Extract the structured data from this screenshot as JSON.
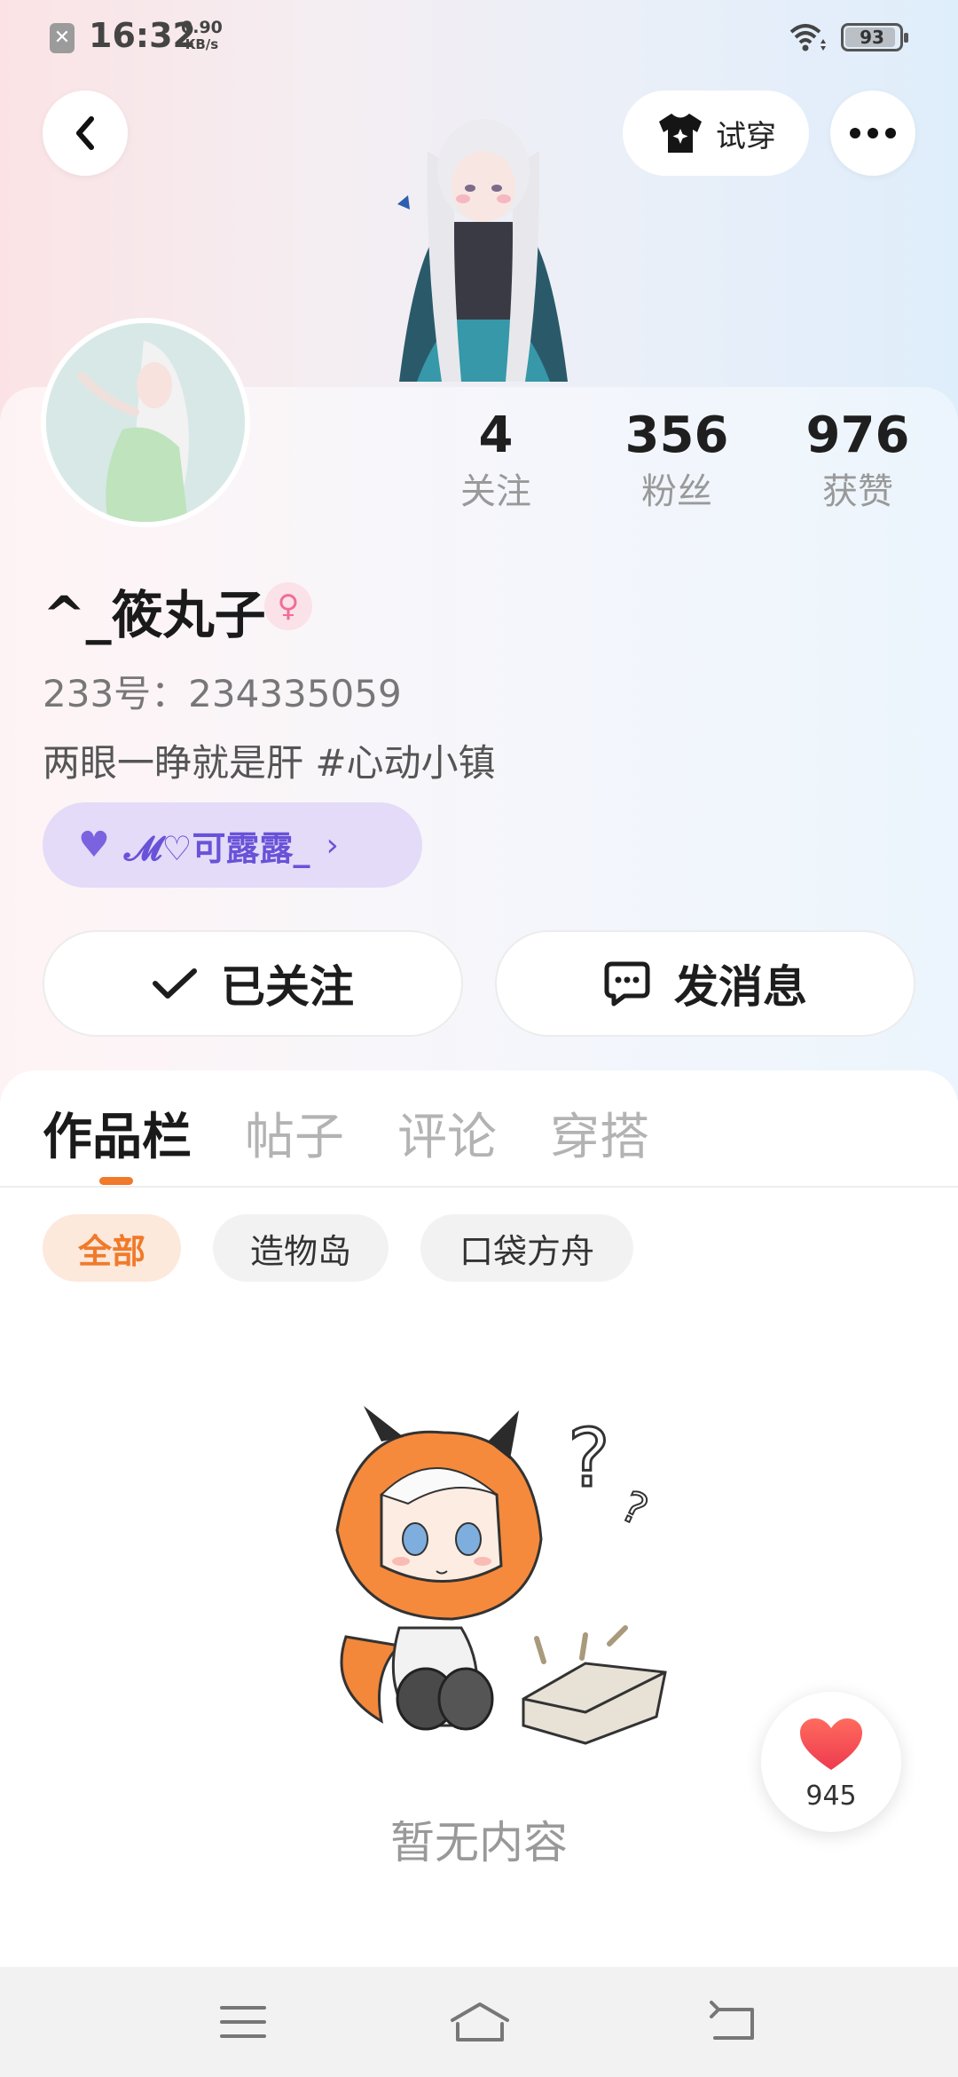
{
  "status_bar": {
    "time": "16:32",
    "speed_value": "0.90",
    "speed_unit": "KB/s",
    "battery": "93",
    "battery_level": 0.93
  },
  "header": {
    "try_on_label": "试穿"
  },
  "profile": {
    "stats": [
      {
        "value": "4",
        "label": "关注"
      },
      {
        "value": "356",
        "label": "粉丝"
      },
      {
        "value": "976",
        "label": "获赞"
      }
    ],
    "name": "^_筱丸子",
    "gender_symbol": "♀",
    "uid": "233号：234335059",
    "bio": "两眼一睁就是肝 #心动小镇",
    "guild_name": "𝓜♡可露露_"
  },
  "actions": {
    "follow_label": "已关注",
    "message_label": "发消息"
  },
  "tabs": [
    "作品栏",
    "帖子",
    "评论",
    "穿搭"
  ],
  "filters": [
    "全部",
    "造物岛",
    "口袋方舟"
  ],
  "empty_state": {
    "text": "暂无内容"
  },
  "like_button": {
    "count": "945"
  },
  "colors": {
    "accent": "#f07a2a",
    "guild": "#6a52d8",
    "like": "#f2545b"
  }
}
